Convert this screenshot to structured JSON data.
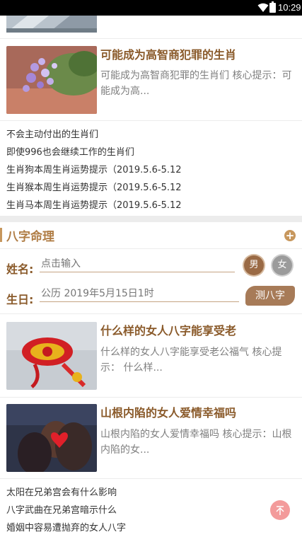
{
  "status_bar": {
    "time": "10:29",
    "wifi_icon": "wifi-icon",
    "battery_icon": "battery-icon"
  },
  "articles": [
    {
      "title": "可能成为高智商犯罪的生肖",
      "desc": "可能成为高智商犯罪的生肖们 核心提示：可能成为高...",
      "image": "flowers-photo"
    },
    {
      "title": "什么样的女人八字能享受老",
      "desc": "什么样的女人八字能享受老公福气 核心提示： 什么样...",
      "image": "red-knot-photo"
    },
    {
      "title": "山根内陷的女人爱情幸福吗",
      "desc": "山根内陷的女人爱情幸福吗 核心提示：山根内陷的女...",
      "image": "couple-photo"
    }
  ],
  "link_list_1": [
    "不会主动付出的生肖们",
    "即使996也会继续工作的生肖们",
    "生肖狗本周生肖运势提示（2019.5.6-5.12",
    "生肖猴本周生肖运势提示（2019.5.6-5.12",
    "生肖马本周生肖运势提示（2019.5.6-5.12"
  ],
  "section": {
    "title": "八字命理",
    "add_icon": "plus-circle-icon"
  },
  "form": {
    "name_label": "姓名:",
    "name_placeholder": "点击输入",
    "male": "男",
    "female": "女",
    "birth_label": "生日:",
    "birth_value": "公历 2019年5月15日1时",
    "submit": "测八字"
  },
  "link_list_2": [
    "太阳在兄弟宫会有什么影响",
    "八字武曲在兄弟宫暗示什么",
    "婚姻中容易遭抛弃的女人八字"
  ],
  "back_to_top_icon": "arrow-up-icon",
  "colors": {
    "accent": "#b07d45",
    "title_brown": "#8a5a2a",
    "back_top": "#f39b9b"
  }
}
